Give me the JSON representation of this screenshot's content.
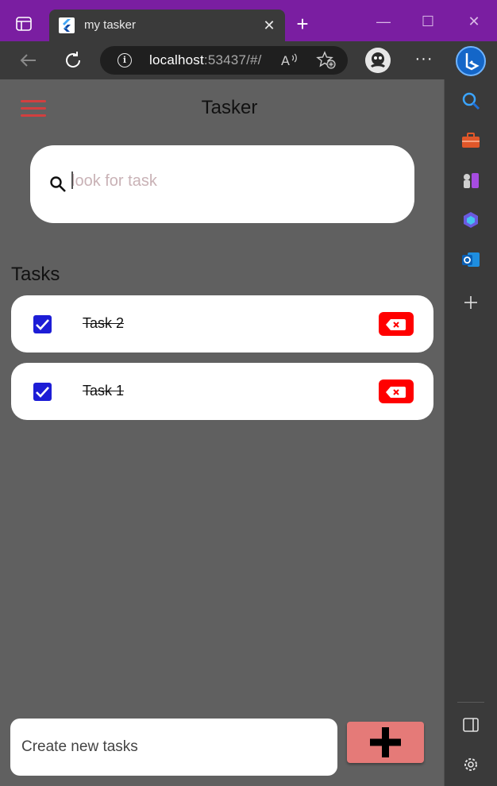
{
  "browser": {
    "tab_title": "my tasker",
    "url_host": "localhost",
    "url_rest": ":53437/#/",
    "read_aloud_label": "Ă"
  },
  "app": {
    "title": "Tasker",
    "search": {
      "placeholder": "look for task",
      "value": ""
    },
    "section_title": "Tasks",
    "tasks": [
      {
        "label": "Task 2",
        "completed": true
      },
      {
        "label": "Task 1",
        "completed": true
      }
    ],
    "new_task": {
      "placeholder": "Create new tasks",
      "value": ""
    }
  },
  "colors": {
    "titlebar": "#7a1ea1",
    "app_background": "#606060",
    "menu_icon": "#d33f3f",
    "checkbox": "#1d1dd6",
    "delete_button": "#ff0000",
    "add_button": "#e57a78"
  },
  "icons": {
    "menu": "hamburger-icon",
    "search": "search-icon",
    "delete": "backspace-x-icon",
    "add": "plus-icon",
    "checkbox": "check-icon"
  }
}
